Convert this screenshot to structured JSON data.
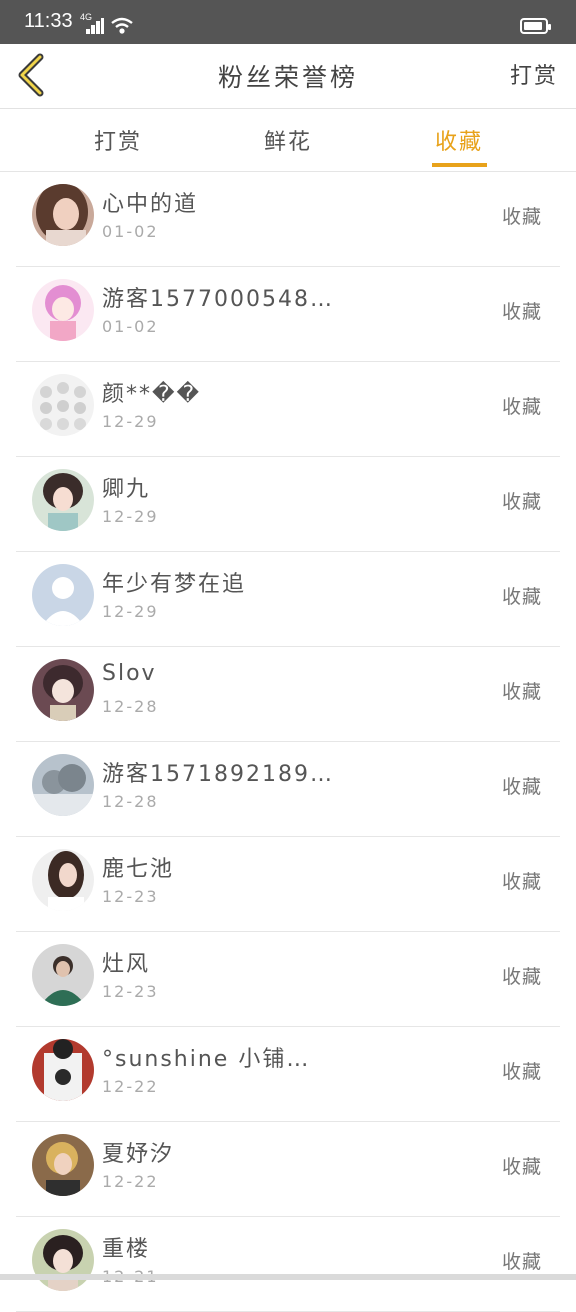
{
  "status_bar": {
    "time": "11:33",
    "network": "4G"
  },
  "header": {
    "title": "粉丝荣誉榜",
    "right_link": "打赏"
  },
  "tabs": [
    {
      "label": "打赏",
      "active": false
    },
    {
      "label": "鲜花",
      "active": false
    },
    {
      "label": "收藏",
      "active": true
    }
  ],
  "colors": {
    "accent": "#e8a21a",
    "status_bar": "#555555"
  },
  "fans": [
    {
      "name": "心中的道",
      "date": "01-02",
      "action": "收藏",
      "avatar": "photo-woman-avatar"
    },
    {
      "name": "游客1577000548…",
      "date": "01-02",
      "action": "收藏",
      "avatar": "anime-girl-pink-avatar"
    },
    {
      "name": "颜**��",
      "date": "12-29",
      "action": "收藏",
      "avatar": "face-grid-avatar"
    },
    {
      "name": "卿九",
      "date": "12-29",
      "action": "收藏",
      "avatar": "anime-girl-avatar"
    },
    {
      "name": "年少有梦在追",
      "date": "12-29",
      "action": "收藏",
      "avatar": "default-user-avatar"
    },
    {
      "name": "Slov",
      "date": "12-28",
      "action": "收藏",
      "avatar": "anime-character-avatar"
    },
    {
      "name": "游客1571892189…",
      "date": "12-28",
      "action": "收藏",
      "avatar": "snowy-tree-avatar"
    },
    {
      "name": "鹿七池",
      "date": "12-23",
      "action": "收藏",
      "avatar": "photo-girl-avatar"
    },
    {
      "name": "灶风",
      "date": "12-23",
      "action": "收藏",
      "avatar": "photo-man-green-avatar"
    },
    {
      "name": "°sunshine 小铺…",
      "date": "12-22",
      "action": "收藏",
      "avatar": "shirt-logo-avatar"
    },
    {
      "name": "夏妤汐",
      "date": "12-22",
      "action": "收藏",
      "avatar": "photo-person-avatar"
    },
    {
      "name": "重楼",
      "date": "12-21",
      "action": "收藏",
      "avatar": "anime-lady-avatar"
    }
  ]
}
